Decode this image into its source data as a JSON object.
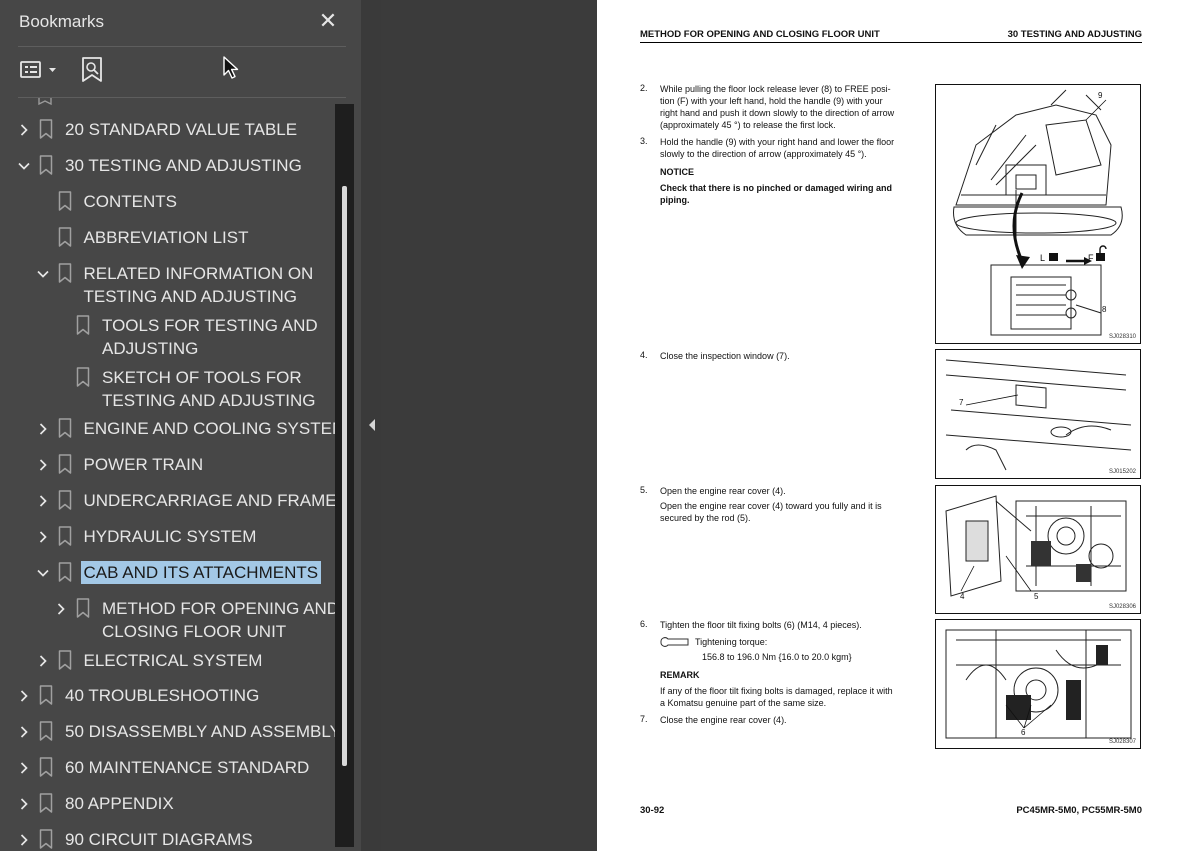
{
  "bookmarks_panel": {
    "title": "Bookmarks",
    "close_glyph": "✕",
    "items": [
      {
        "label": "20 STANDARD VALUE TABLE",
        "level": 0,
        "state": "collapsed"
      },
      {
        "label": "30 TESTING AND ADJUSTING",
        "level": 0,
        "state": "expanded"
      },
      {
        "label": "CONTENTS",
        "level": 1,
        "state": "leaf"
      },
      {
        "label": "ABBREVIATION LIST",
        "level": 1,
        "state": "leaf"
      },
      {
        "label_lines": [
          "RELATED INFORMATION ON",
          "TESTING AND ADJUSTING"
        ],
        "level": 1,
        "state": "expanded"
      },
      {
        "label_lines": [
          "TOOLS FOR TESTING AND",
          "ADJUSTING"
        ],
        "level": 2,
        "state": "leaf"
      },
      {
        "label_lines": [
          "SKETCH OF TOOLS FOR",
          "TESTING AND ADJUSTING"
        ],
        "level": 2,
        "state": "leaf"
      },
      {
        "label": "ENGINE AND COOLING SYSTEM",
        "level": 1,
        "state": "collapsed"
      },
      {
        "label": "POWER TRAIN",
        "level": 1,
        "state": "collapsed"
      },
      {
        "label": "UNDERCARRIAGE AND FRAME",
        "level": 1,
        "state": "collapsed"
      },
      {
        "label": "HYDRAULIC SYSTEM",
        "level": 1,
        "state": "collapsed"
      },
      {
        "label": "CAB AND ITS ATTACHMENTS",
        "level": 1,
        "state": "expanded",
        "selected": true
      },
      {
        "label_lines": [
          "METHOD FOR OPENING AND",
          "CLOSING FLOOR UNIT"
        ],
        "level": 2,
        "state": "collapsed"
      },
      {
        "label": "ELECTRICAL SYSTEM",
        "level": 1,
        "state": "collapsed"
      },
      {
        "label": "40 TROUBLESHOOTING",
        "level": 0,
        "state": "collapsed"
      },
      {
        "label": "50 DISASSEMBLY AND ASSEMBLY",
        "level": 0,
        "state": "collapsed"
      },
      {
        "label": "60 MAINTENANCE STANDARD",
        "level": 0,
        "state": "collapsed"
      },
      {
        "label": "80 APPENDIX",
        "level": 0,
        "state": "collapsed"
      },
      {
        "label": "90 CIRCUIT DIAGRAMS",
        "level": 0,
        "state": "collapsed"
      }
    ]
  },
  "colors": {
    "panel_bg": "#474747",
    "viewer_bg": "#3b3b3b",
    "selection_bg": "#a3c8e6",
    "text": "#e6e6e6"
  },
  "page": {
    "header_left": "METHOD FOR OPENING AND CLOSING FLOOR UNIT",
    "header_right": "30 TESTING AND ADJUSTING",
    "step2_num": "2.",
    "step2_lines": [
      "While pulling the floor lock release lever (8) to FREE posi-",
      "tion (F) with your left hand, hold the handle (9) with your",
      "right hand and push it down slowly to the direction of arrow",
      "(approximately 45 °) to release the first lock."
    ],
    "step3_num": "3.",
    "step3_lines": [
      "Hold the handle (9) with your right hand and lower the floor",
      "slowly to the direction of arrow (approximately 45 °)."
    ],
    "notice_title": "NOTICE",
    "notice_lines": [
      "Check that there is no pinched or damaged wiring and",
      "piping."
    ],
    "step4_num": "4.",
    "step4_text": "Close the inspection window (7).",
    "step5_num": "5.",
    "step5_title": "Open the engine rear cover (4).",
    "step5_lines": [
      "Open the engine rear cover (4) toward you fully and it is",
      "secured by the rod (5)."
    ],
    "step6_num": "6.",
    "step6_title": "Tighten the floor tilt fixing bolts (6) (M14, 4 pieces).",
    "torque_label": "Tightening torque:",
    "torque_value": "156.8 to 196.0 Nm {16.0 to 20.0 kgm}",
    "remark_title": "REMARK",
    "remark_lines": [
      "If any of the floor tilt fixing bolts is damaged, replace it with",
      "a Komatsu genuine part of the same size."
    ],
    "step7_num": "7.",
    "step7_text": "Close the engine rear cover (4).",
    "fig1_code": "SJ028310",
    "fig1_labels": {
      "nine": "9",
      "eight": "8",
      "lock": "L",
      "free": "F"
    },
    "fig2_code": "SJ015202",
    "fig2_label": "7",
    "fig3_code": "SJ028306",
    "fig3_labels": {
      "four": "4",
      "five": "5"
    },
    "fig4_code": "SJ028307",
    "fig4_label": "6",
    "footer_left": "30-92",
    "footer_right": "PC45MR-5M0, PC55MR-5M0"
  }
}
